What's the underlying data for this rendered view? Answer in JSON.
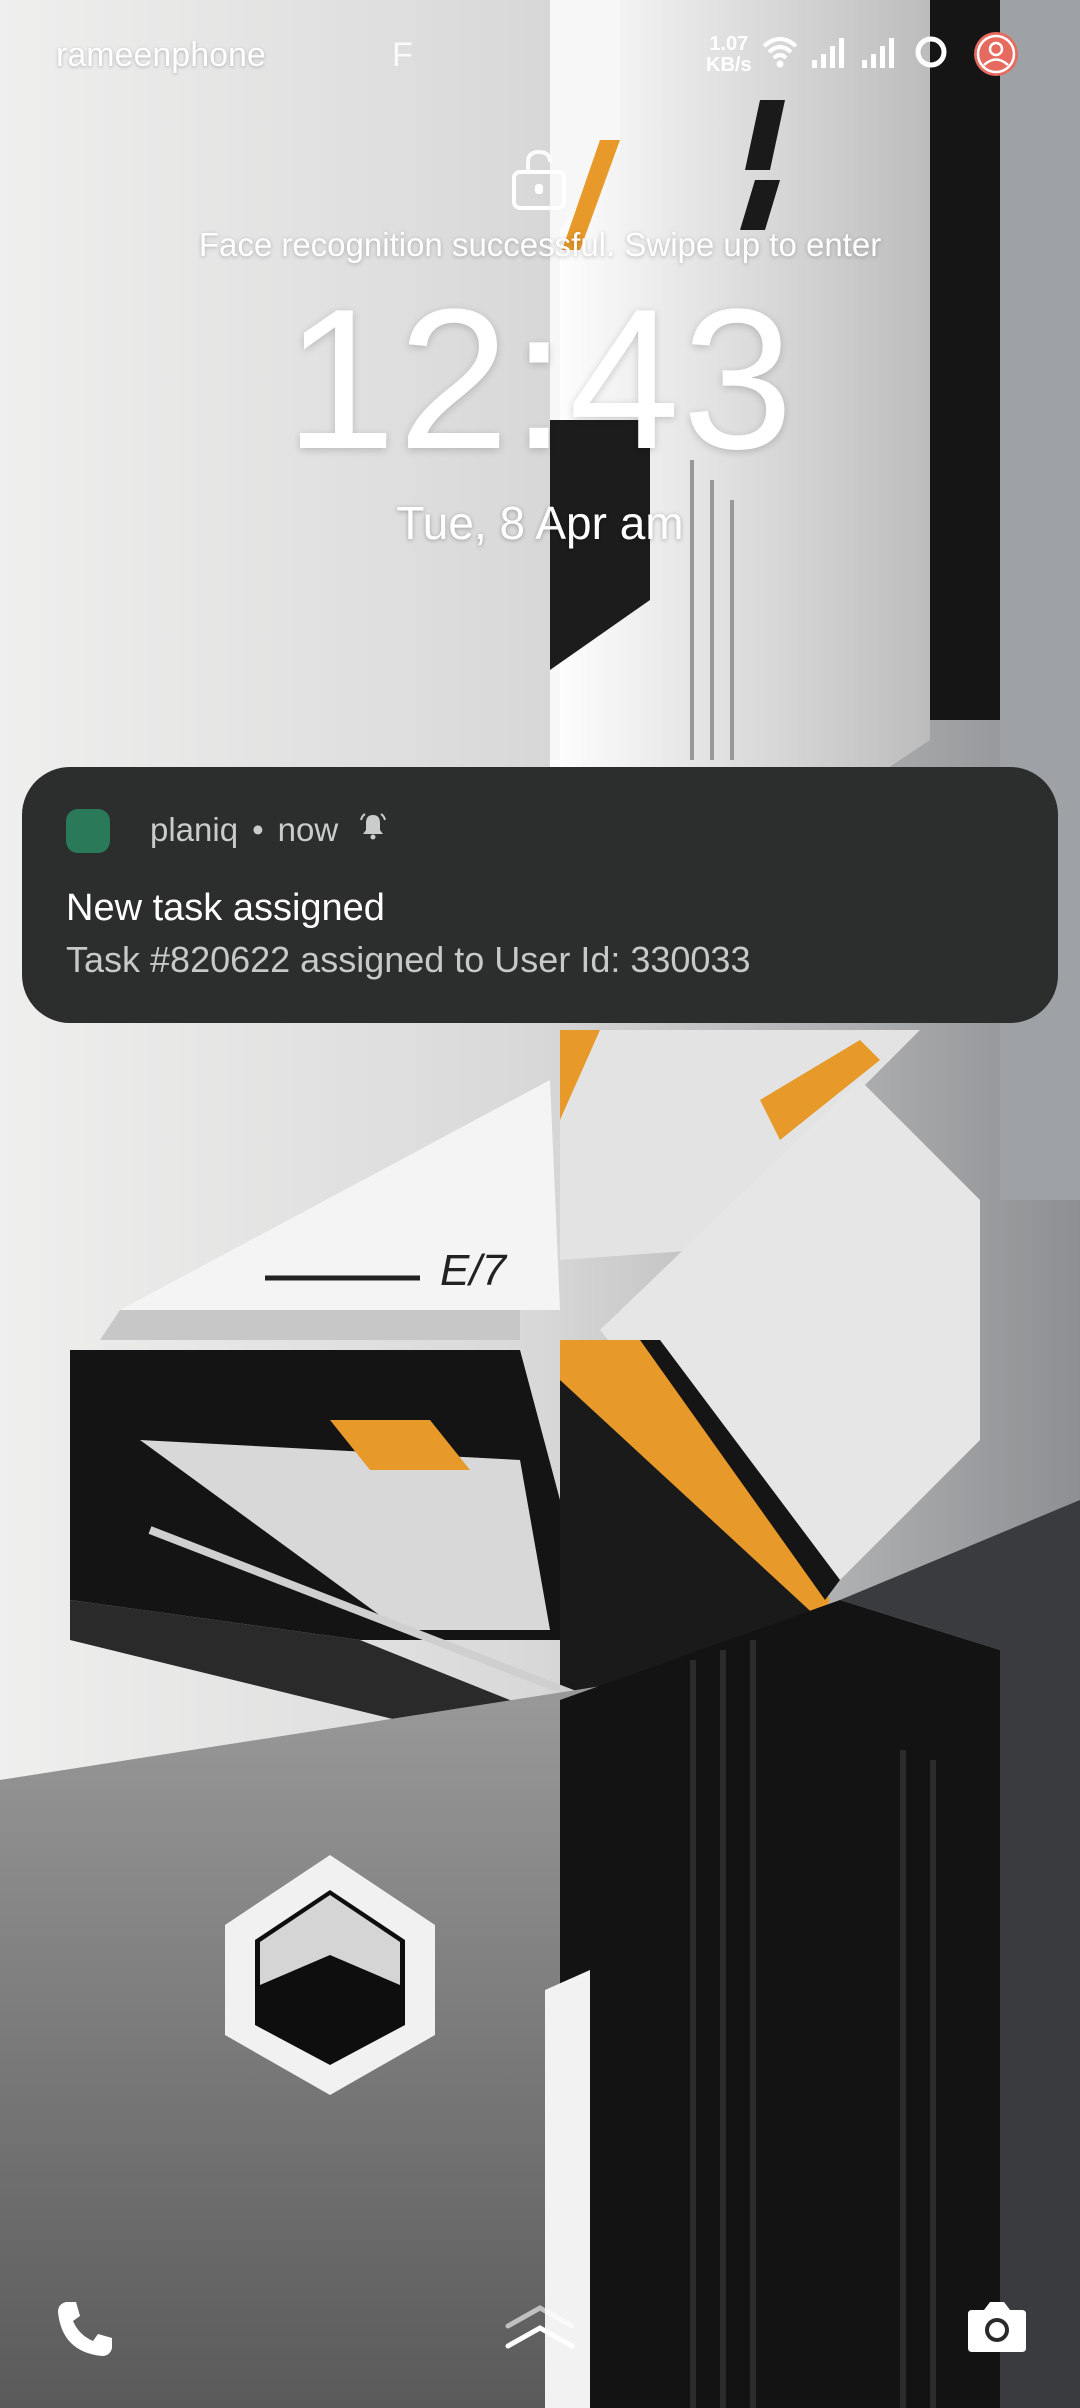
{
  "status_bar": {
    "carrier": "rameenphone",
    "carrier_extra": "F",
    "net_speed_value": "1.07",
    "net_speed_unit": "KB/s",
    "icons": [
      "wifi-icon",
      "signal-sim1-icon",
      "signal-sim2-icon",
      "battery-ring-icon",
      "profile-icon"
    ]
  },
  "lock": {
    "face_message": "Face recognition successful. Swipe up to enter",
    "time": "12:43",
    "date": "Tue, 8 Apr  am"
  },
  "notification": {
    "app_name": "planiq",
    "separator": "•",
    "when": "now",
    "title": "New task assigned",
    "body": "Task #820622 assigned to User Id: 330033",
    "app_icon_color": "#2a7a5a",
    "background": "#2b2e2c"
  },
  "bottom": {
    "left_icon": "phone-icon",
    "center_icon": "swipe-up-chevron-icon",
    "right_icon": "camera-icon"
  },
  "colors": {
    "accent_orange": "#e79a2a",
    "dark": "#141414"
  }
}
